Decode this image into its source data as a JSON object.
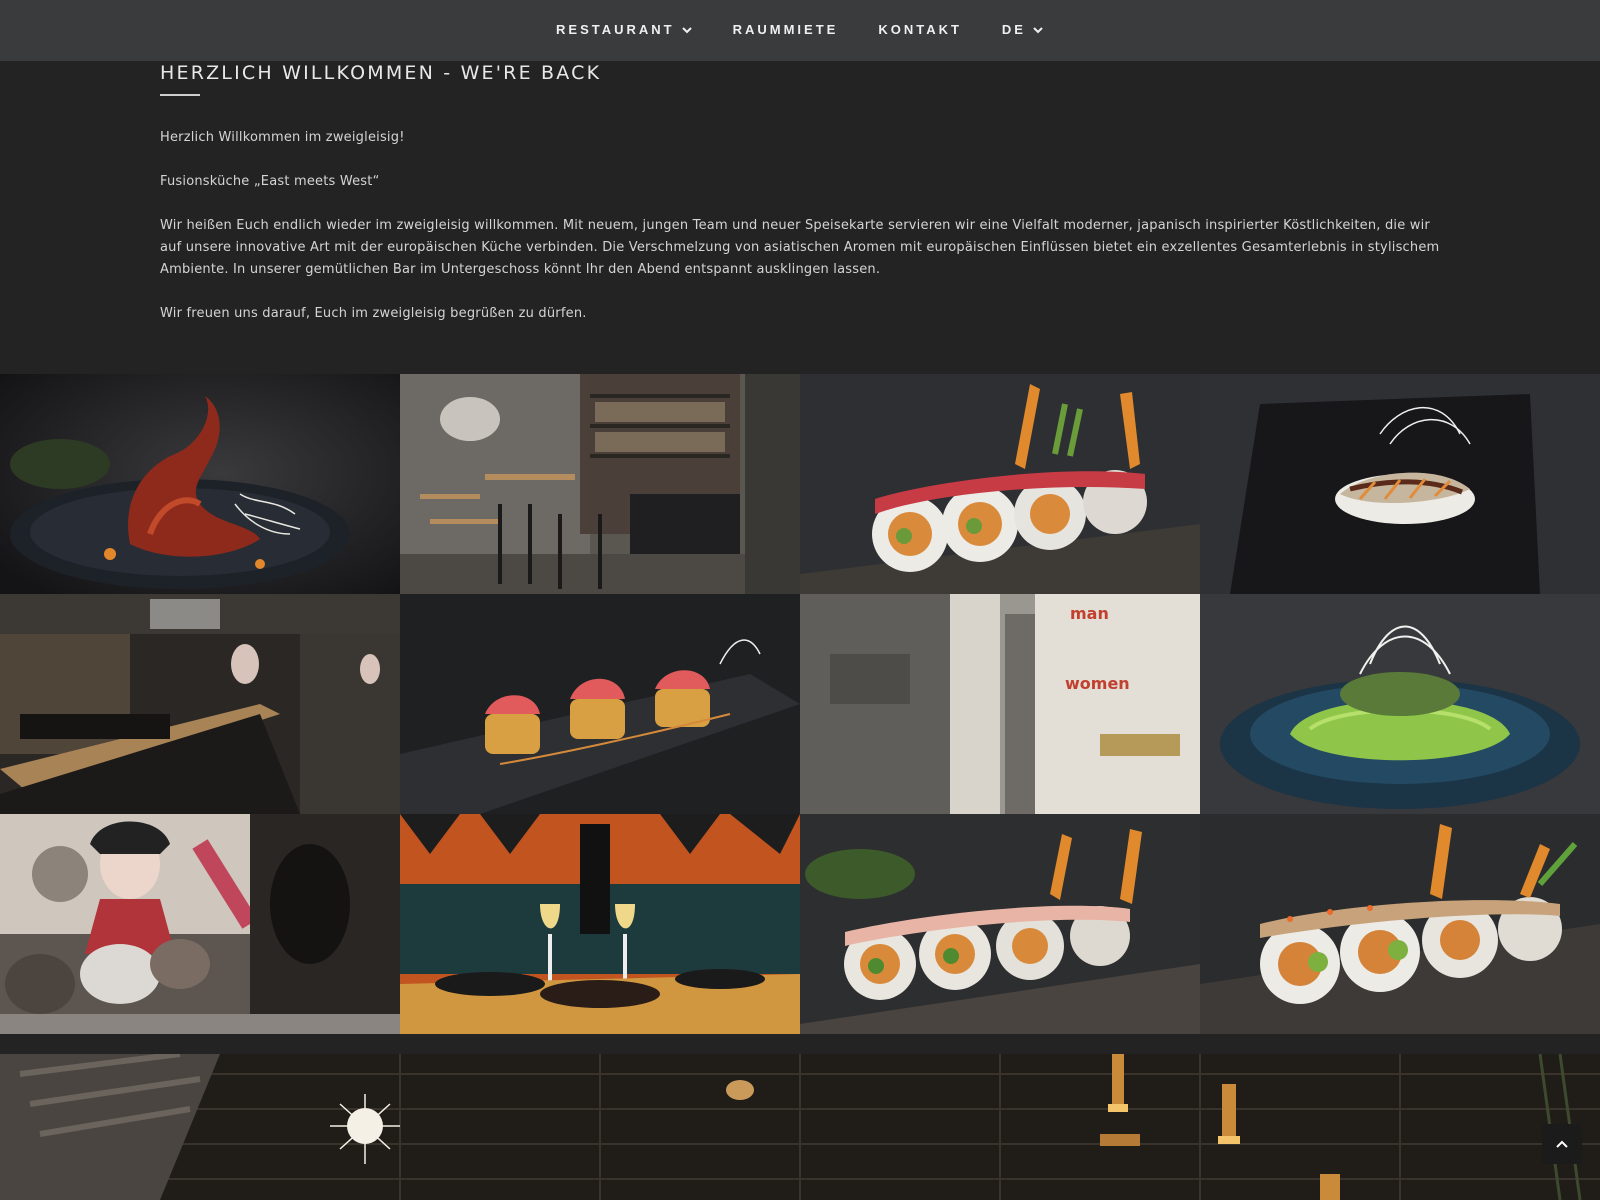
{
  "nav": {
    "items": [
      {
        "label": "RESTAURANT",
        "has_dropdown": true
      },
      {
        "label": "RAUMMIETE",
        "has_dropdown": false
      },
      {
        "label": "KONTAKT",
        "has_dropdown": false
      },
      {
        "label": "DE",
        "has_dropdown": true
      }
    ]
  },
  "intro": {
    "title": "HERZLICH WILLKOMMEN - WE'RE BACK",
    "paragraphs": [
      "Herzlich Willkommen im zweigleisig!",
      "Fusionsküche „East meets West“",
      "Wir heißen Euch endlich wieder im zweigleisig willkommen. Mit neuem, jungen Team und neuer Speisekarte servieren wir eine Vielfalt moderner, japanisch inspirierter Köstlichkeiten, die wir auf unsere innovative Art mit der europäischen Küche verbinden. Die Verschmelzung von asiatischen Aromen mit europäischen Einflüssen bietet ein exzellentes Gesamterlebnis in stylischem Ambiente. In unserer gemütlichen Bar im Untergeschoss könnt Ihr den Abend entspannt ausklingen lassen.",
      "Wir freuen uns darauf, Euch im zweigleisig begrüßen zu dürfen."
    ]
  },
  "gallery": {
    "tiles": [
      {
        "subject": "octopus-dish"
      },
      {
        "subject": "bar-interior"
      },
      {
        "subject": "sushi-rolls-tuna"
      },
      {
        "subject": "nigiri-plate"
      },
      {
        "subject": "restaurant-counter"
      },
      {
        "subject": "crispy-rice-tuna"
      },
      {
        "subject": "restroom-door-sign"
      },
      {
        "subject": "avocado-salad"
      },
      {
        "subject": "guests-geisha-mural"
      },
      {
        "subject": "champagne-table"
      },
      {
        "subject": "sushi-rolls-salmon"
      },
      {
        "subject": "sushi-rolls-avocado"
      }
    ]
  },
  "colors": {
    "nav_bg": "#3a3b3c",
    "page_bg": "#232323",
    "text": "#d4d4d4"
  }
}
